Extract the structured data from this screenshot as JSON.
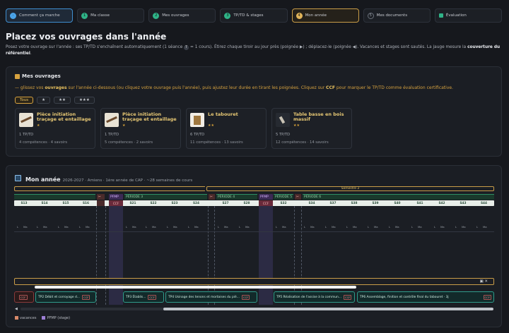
{
  "steps": [
    {
      "num": "",
      "label": "Comment ça marche",
      "state": "done"
    },
    {
      "num": "1",
      "label": "Ma classe",
      "state": "ok"
    },
    {
      "num": "2",
      "label": "Mes ouvrages",
      "state": "ok"
    },
    {
      "num": "3",
      "label": "TP/TD & stages",
      "state": "ok"
    },
    {
      "num": "4",
      "label": "Mon année",
      "state": "current"
    },
    {
      "num": "5",
      "label": "Mes documents",
      "state": "pending"
    },
    {
      "num": "",
      "label": "Évaluation",
      "state": "last"
    }
  ],
  "header": {
    "title": "Placez vos ouvrages dans l'année",
    "intro_a": "Posez votre ouvrage sur l'année : ses TP/TD s'enchaînent automatiquement (1 séance ",
    "intro_icon": "T",
    "intro_b": " = 1 cours). Étirez chaque tiroir au jour près (poignée ▶) ; déplacez-le (poignée ◀). Vacances et stages sont sautés. La jauge mesure la ",
    "intro_bold": "couverture du référentiel",
    "intro_end": "."
  },
  "works": {
    "title": "Mes ouvrages",
    "hint_a": "— glissez vos ",
    "hint_bold": "ouvrages",
    "hint_b": " sur l'année ci-dessous (ou cliquez votre ouvrage puis l'année), puis ajustez leur durée en tirant les poignées. Cliquez sur ",
    "hint_ccf": "CCF",
    "hint_c": " pour marquer le TP/TD comme évaluation certificative.",
    "filters": [
      "Tous",
      "★",
      "★★",
      "★★★"
    ],
    "cards": [
      {
        "name": "Pièce initiation traçage et entaillage",
        "stars": "★",
        "tp": "1 TP/TD",
        "comp": "4 compétences · 4 savoirs",
        "thumb": "plank"
      },
      {
        "name": "Pièce initiation traçage et entaillage",
        "stars": "★",
        "tp": "1 TP/TD",
        "comp": "5 compétences · 2 savoirs",
        "thumb": "plank"
      },
      {
        "name": "Le tabouret",
        "stars": "★★",
        "tp": "6 TP/TD",
        "comp": "11 compétences · 13 savoirs",
        "thumb": "stool"
      },
      {
        "name": "Table basse en bois massif",
        "stars": "★★",
        "tp": "5 TP/TD",
        "comp": "12 compétences · 14 savoirs",
        "thumb": "dark"
      }
    ]
  },
  "year": {
    "title": "Mon année",
    "meta": "2026-2027 · Amiens · 1ère année de CAP · ~28 semaines de cours",
    "semester2": "Semestre 2",
    "periods": [
      {
        "label": "✂",
        "type": "v"
      },
      {
        "label": "PFMP",
        "type": "s"
      },
      {
        "label": "PÉRIODE 3",
        "type": "p"
      },
      {
        "label": "✂",
        "type": "v"
      },
      {
        "label": "PÉRIODE 4",
        "type": "p"
      },
      {
        "label": "PFMP",
        "type": "s"
      },
      {
        "label": "PÉRIODE 5",
        "type": "p"
      },
      {
        "label": "✂",
        "type": "v"
      },
      {
        "label": "PÉRIODE 6",
        "type": "p"
      }
    ],
    "ccf_labels": [
      "CCF",
      "CCF"
    ],
    "weeks": [
      "S13",
      "S14",
      "S15",
      "S16",
      "S17",
      "S21",
      "S22",
      "S23",
      "S24",
      "S25",
      "S27",
      "S28",
      "S29",
      "S32",
      "S33",
      "S34",
      "S36",
      "S37",
      "S38",
      "S39",
      "S40",
      "S41",
      "S42",
      "S43",
      "S44"
    ],
    "days": [
      "L",
      "Ma",
      "L",
      "Ma",
      "L",
      "Ma",
      "L",
      "Ma",
      "L",
      "Ma",
      "L",
      "Ma",
      "L",
      "Ma",
      "L",
      "Ma",
      "L",
      "Ma",
      "L",
      "Ma",
      "L",
      "Ma",
      "L",
      "Ma",
      "L",
      "Ma",
      "L",
      "Ma",
      "L",
      "Ma",
      "L",
      "Ma",
      "L",
      "Ma",
      "L",
      "Ma",
      "L",
      "Ma",
      "L",
      "Ma",
      "L",
      "Ma",
      "L",
      "Ma",
      "L",
      "Ma"
    ],
    "blocks": [
      {
        "label": "CCF",
        "ccf": ""
      },
      {
        "label": "TP2 Débit et corroyage d...",
        "ccf": "CCF"
      },
      {
        "label": "TP3 Établis...",
        "ccf": "CCF"
      },
      {
        "label": "TP4 Usinage des tenons et mortaises du pié...",
        "ccf": "CCF"
      },
      {
        "label": "TP5 Réalisation de l'assise à la commun...",
        "ccf": "CCF"
      },
      {
        "label": "TP6 Assemblage, finition et contrôle final du tabouret · 3j",
        "ccf": "CCF"
      }
    ],
    "gauge_icons": "▣ ✕",
    "legend": [
      {
        "label": "vacances",
        "color": "#d98a6a"
      },
      {
        "label": "PFMP (stage)",
        "color": "#9d7fd6"
      }
    ]
  }
}
